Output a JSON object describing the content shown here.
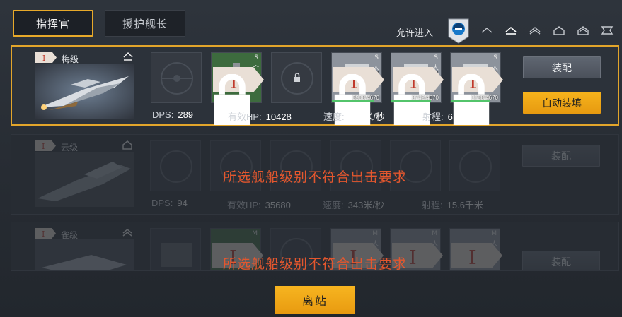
{
  "tabs": {
    "commander": "指挥官",
    "escort": "援护舰长"
  },
  "header": {
    "allow_label": "允许进入"
  },
  "ships": [
    {
      "class_badge": "I",
      "class_name": "梅级",
      "stats": {
        "dps_label": "DPS:",
        "dps": "289",
        "hp_label": "有效HP:",
        "hp": "10428",
        "speed_label": "速度:",
        "speed": "638米/秒",
        "range_label": "射程:",
        "range": "6千米"
      },
      "slots": [
        {
          "badge": "",
          "type": "",
          "sub": ""
        },
        {
          "badge": "I",
          "type": "S",
          "sub": "-:-"
        },
        {
          "badge": "",
          "type": "",
          "sub": ""
        },
        {
          "badge": "I",
          "type": "S",
          "sub": "人",
          "durability": "3908/4670",
          "fill": 0.84
        },
        {
          "badge": "I",
          "type": "S",
          "sub": "人",
          "durability": "3742/4670",
          "fill": 0.8
        },
        {
          "badge": "I",
          "type": "S",
          "sub": "人",
          "durability": "3758/4670",
          "fill": 0.8
        }
      ],
      "equip_label": "装配",
      "auto_label": "自动装填"
    },
    {
      "class_badge": "I",
      "class_name": "云级",
      "stats": {
        "dps_label": "DPS:",
        "dps": "94",
        "hp_label": "有效HP:",
        "hp": "35680",
        "speed_label": "速度:",
        "speed": "343米/秒",
        "range_label": "射程:",
        "range": "15.6千米"
      },
      "equip_label": "装配",
      "warning": "所选舰船级别不符合出击要求"
    },
    {
      "class_badge": "I",
      "class_name": "雀级",
      "slots": [
        {
          "badge": "",
          "type": "",
          "sub": ""
        },
        {
          "badge": "I",
          "type": "M",
          "sub": ""
        },
        {
          "badge": "",
          "type": "",
          "sub": ""
        },
        {
          "badge": "I",
          "type": "M",
          "sub": "人"
        },
        {
          "badge": "I",
          "type": "M",
          "sub": "人"
        },
        {
          "badge": "I",
          "type": "M",
          "sub": "人"
        }
      ],
      "equip_label": "装配",
      "warning": "所选舰船级别不符合出击要求"
    }
  ],
  "footer": {
    "leave_label": "离站"
  },
  "colors": {
    "accent": "#e7a92a",
    "warning": "#e4572e",
    "slot_green": "#3d6b3e"
  }
}
